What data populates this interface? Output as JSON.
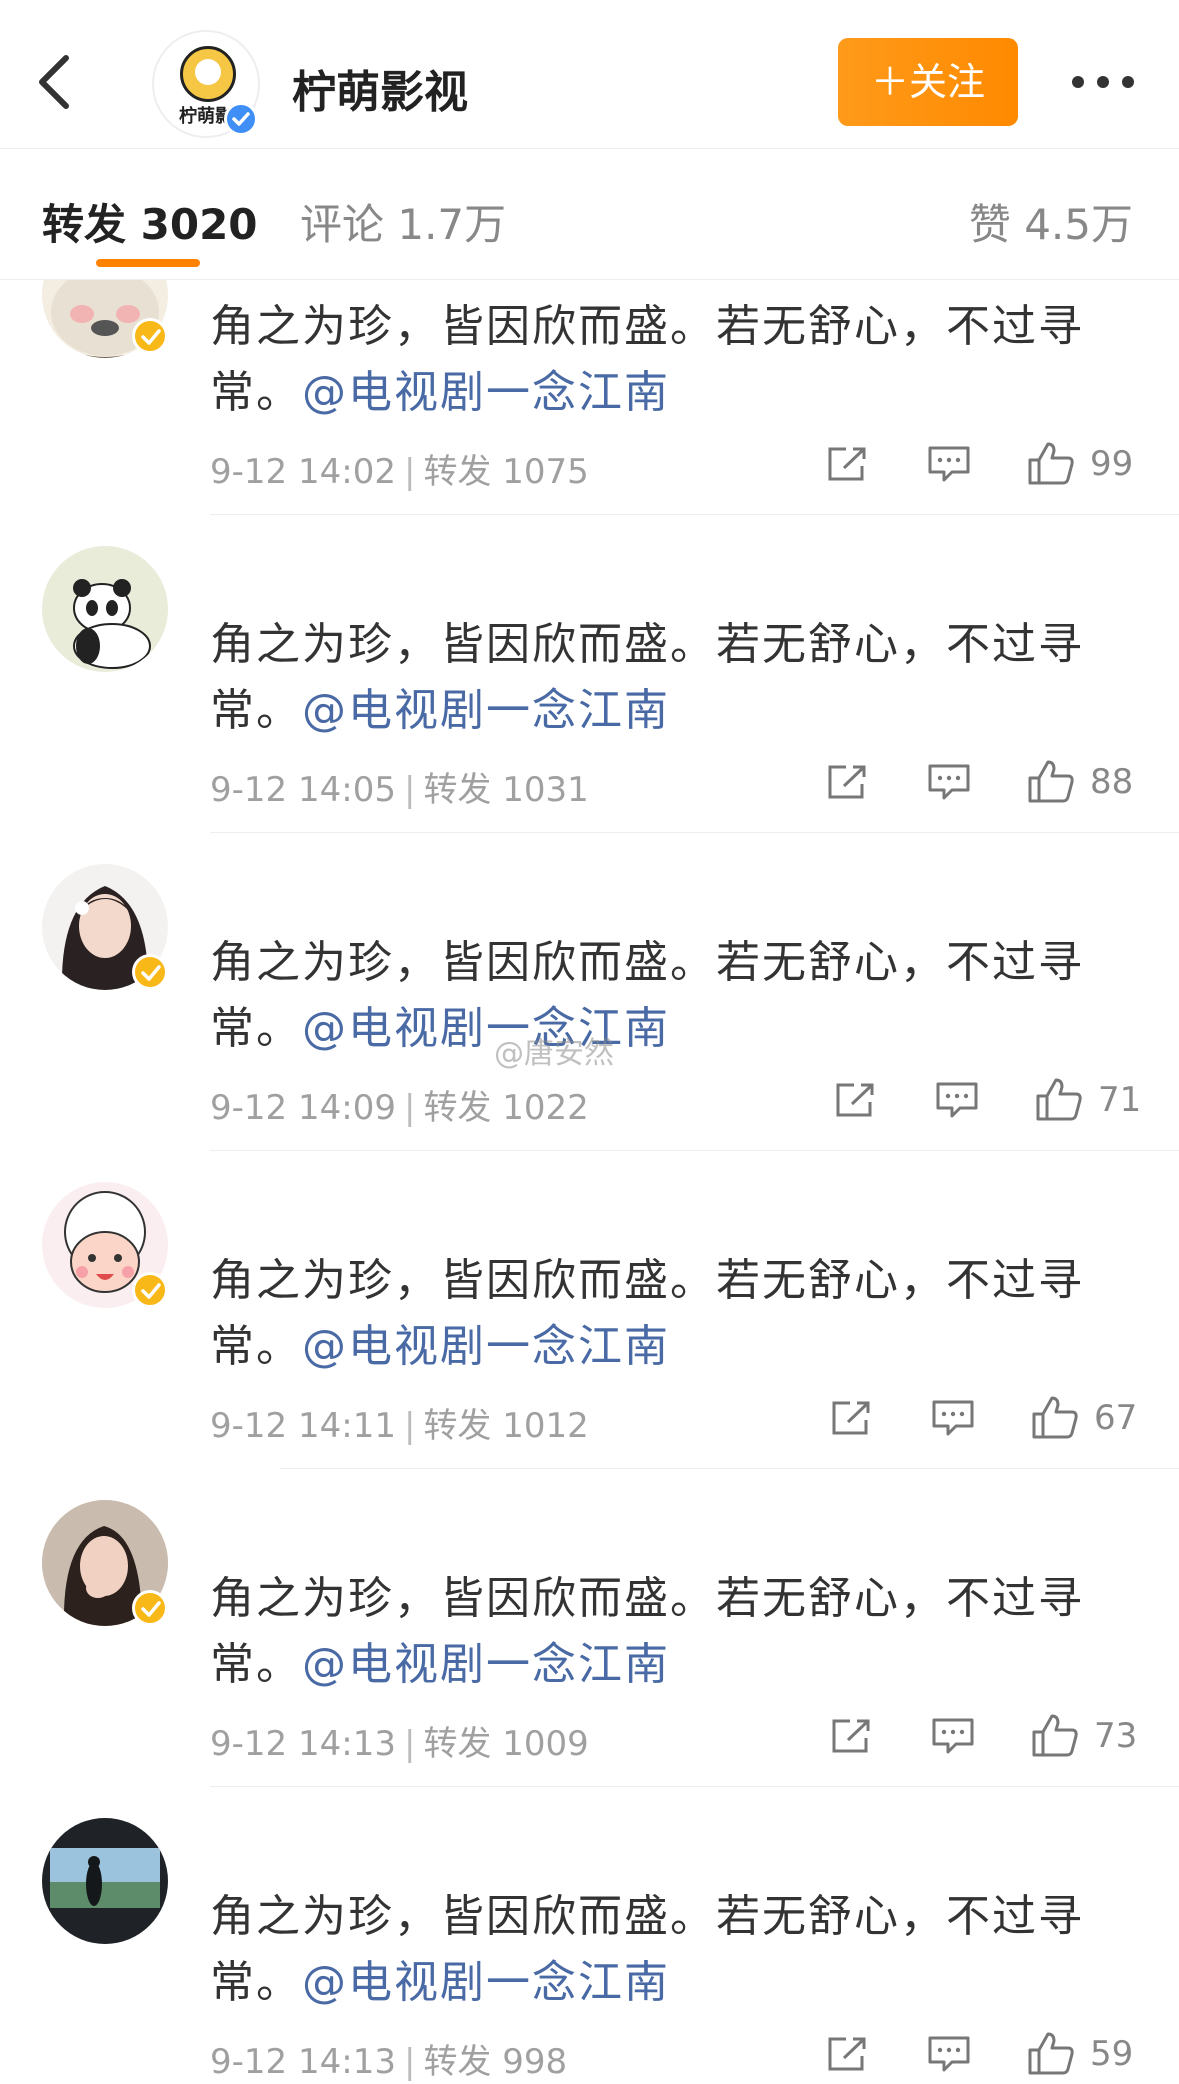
{
  "header": {
    "account_name": "柠萌影视",
    "logo_text": "柠萌影",
    "follow_label": "＋关注"
  },
  "tabs": {
    "repost": "转发 3020",
    "comment": "评论 1.7万",
    "like": "赞 4.5万"
  },
  "post_text": "角之为珍，皆因欣而盛。若无舒心，不过寻常。",
  "mention": "@电视剧一念江南",
  "items": [
    {
      "time": "9-12 14:02",
      "reposts": "转发 1075",
      "likes": "99"
    },
    {
      "time": "9-12 14:05",
      "reposts": "转发 1031",
      "likes": "88"
    },
    {
      "time": "9-12 14:09",
      "reposts": "转发 1022",
      "likes": "71"
    },
    {
      "time": "9-12 14:11",
      "reposts": "转发 1012",
      "likes": "67"
    },
    {
      "time": "9-12 14:13",
      "reposts": "转发 1009",
      "likes": "73"
    },
    {
      "time": "9-12 14:13",
      "reposts": "转发 998",
      "likes": "59"
    }
  ],
  "watermark": "@唐安然",
  "colors": {
    "accent": "#ff8200",
    "follow_button": "#ff8a00",
    "mention": "#4a6aa5",
    "verified_gold": "#f8b818",
    "verified_blue": "#3f8ff7"
  },
  "icons": [
    "back-icon",
    "more-icon",
    "share-icon",
    "comment-icon",
    "like-icon",
    "verified-badge-icon"
  ]
}
